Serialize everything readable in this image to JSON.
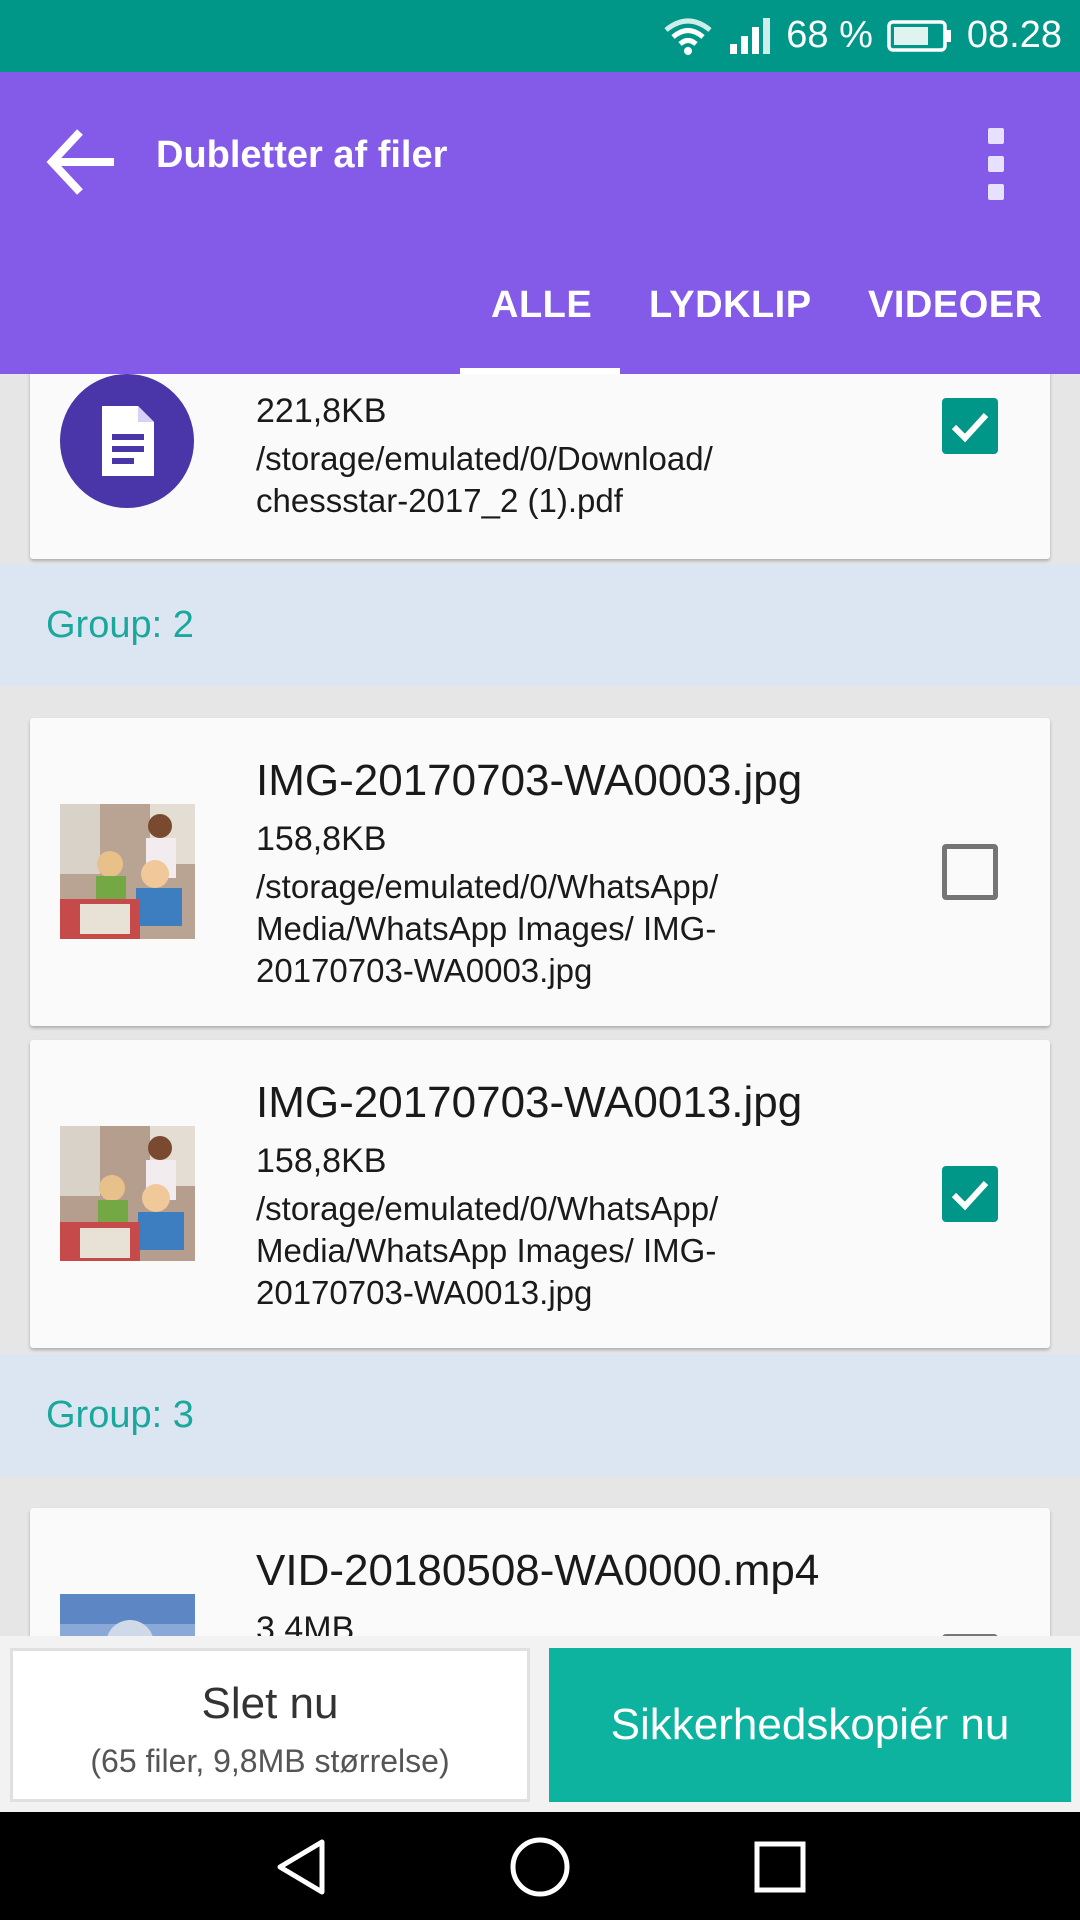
{
  "statusbar": {
    "battery": "68 %",
    "time": "08.28"
  },
  "appbar": {
    "title": "Dubletter af filer"
  },
  "tabs": [
    {
      "label": "ALLE",
      "active": true
    },
    {
      "label": "LYDKLIP",
      "active": false
    },
    {
      "label": "VIDEOER",
      "active": false
    }
  ],
  "items_top": {
    "size": "221,8KB",
    "path": "/storage/emulated/0/Download/ chessstar-2017_2 (1).pdf",
    "checked": true
  },
  "groups": [
    {
      "label": "Group: 2",
      "files": [
        {
          "name": "IMG-20170703-WA0003.jpg",
          "size": "158,8KB",
          "path": "/storage/emulated/0/WhatsApp/ Media/WhatsApp Images/ IMG-20170703-WA0003.jpg",
          "checked": false
        },
        {
          "name": "IMG-20170703-WA0013.jpg",
          "size": "158,8KB",
          "path": "/storage/emulated/0/WhatsApp/ Media/WhatsApp Images/ IMG-20170703-WA0013.jpg",
          "checked": true
        }
      ]
    },
    {
      "label": "Group: 3",
      "files": [
        {
          "name": "VID-20180508-WA0000.mp4",
          "size": "3,4MB"
        }
      ]
    }
  ],
  "bottom": {
    "delete_label": "Slet nu",
    "delete_sub": "(65 filer, 9,8MB størrelse)",
    "backup_label": "Sikkerhedskopiér nu"
  },
  "colors": {
    "statusbar": "#009688",
    "appbar": "#845ae9",
    "accent": "#009688",
    "group_text": "#1aa89d",
    "group_bg": "#dce6f2"
  },
  "icons": [
    "wifi-icon",
    "signal-icon",
    "battery-icon",
    "back-arrow-icon",
    "more-vert-icon",
    "document-icon",
    "checkbox-icon",
    "nav-back-icon",
    "nav-home-icon",
    "nav-recents-icon"
  ]
}
